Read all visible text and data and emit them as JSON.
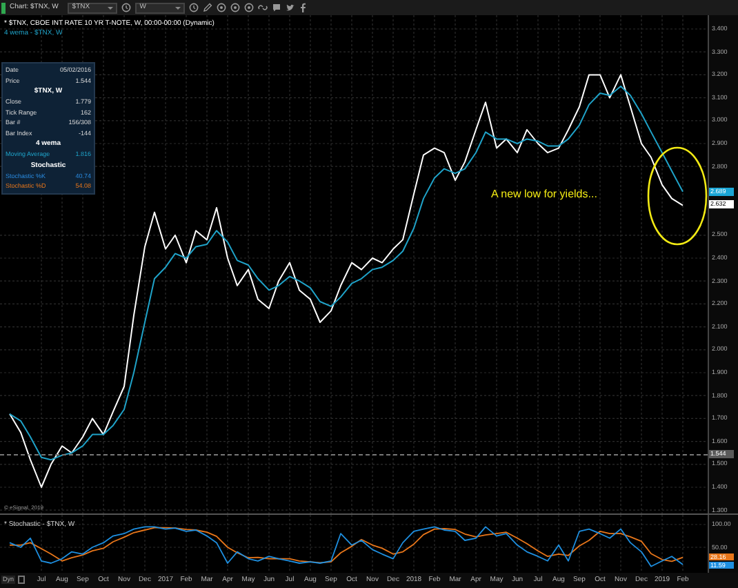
{
  "toolbar": {
    "title": "Chart: $TNX, W",
    "symbol_field": {
      "value": "$TNX"
    },
    "interval_field": {
      "value": "W"
    }
  },
  "chart": {
    "data_window": [
      {
        "kind": "pair",
        "label": "Date",
        "value": "05/02/2016"
      },
      {
        "kind": "pair",
        "label": "Price",
        "value": "1.544"
      },
      {
        "kind": "header",
        "label": "$TNX, W"
      },
      {
        "kind": "pair",
        "label": "Close",
        "value": "1.779"
      },
      {
        "kind": "pair",
        "label": "Tick Range",
        "value": "162"
      },
      {
        "kind": "pair",
        "label": "Bar #",
        "value": "156/308"
      },
      {
        "kind": "pair",
        "label": "Bar Index",
        "value": "-144"
      },
      {
        "kind": "header",
        "label": "4 wema"
      },
      {
        "kind": "moving_average",
        "label": "Moving Average",
        "value": "1.816"
      },
      {
        "kind": "header",
        "label": "Stochastic"
      },
      {
        "kind": "stochastic_k",
        "label": "Stochastic %K",
        "value": "40.74"
      },
      {
        "kind": "stochastic_d",
        "label": "Stochastic %D",
        "value": "54.08"
      }
    ],
    "annotation": "A new low for yields...",
    "axis_labels": [
      {
        "kind": "series_last",
        "text": "2.689",
        "color": "#1aa6d6"
      },
      {
        "kind": "series_last",
        "text": "2.632",
        "color": "#ffffff"
      }
    ],
    "copyright": "© eSignal, 2019",
    "chart_data": {
      "type": "line",
      "x": [
        "2016-05-15",
        "2016-06-01",
        "2016-06-15",
        "2016-07-01",
        "2016-07-15",
        "2016-08-01",
        "2016-08-15",
        "2016-09-01",
        "2016-09-15",
        "2016-10-01",
        "2016-10-15",
        "2016-11-01",
        "2016-11-15",
        "2016-12-01",
        "2016-12-15",
        "2017-01-01",
        "2017-01-15",
        "2017-02-01",
        "2017-02-15",
        "2017-03-01",
        "2017-03-15",
        "2017-04-01",
        "2017-04-15",
        "2017-05-01",
        "2017-05-15",
        "2017-06-01",
        "2017-06-15",
        "2017-07-01",
        "2017-07-15",
        "2017-08-01",
        "2017-08-15",
        "2017-09-01",
        "2017-09-15",
        "2017-10-01",
        "2017-10-15",
        "2017-11-01",
        "2017-11-15",
        "2017-12-01",
        "2017-12-15",
        "2018-01-01",
        "2018-01-15",
        "2018-02-01",
        "2018-02-15",
        "2018-03-01",
        "2018-03-15",
        "2018-04-01",
        "2018-04-15",
        "2018-05-01",
        "2018-05-15",
        "2018-06-01",
        "2018-06-15",
        "2018-07-01",
        "2018-07-15",
        "2018-08-01",
        "2018-08-15",
        "2018-09-01",
        "2018-09-15",
        "2018-10-01",
        "2018-10-15",
        "2018-11-01",
        "2018-11-15",
        "2018-12-01",
        "2018-12-15",
        "2019-01-01",
        "2019-01-15",
        "2019-02-01"
      ],
      "series": [
        {
          "name": "* $TNX, CBOE INT RATE 10 YR T-NOTE, W, 00:00-00:00 (Dynamic)",
          "color": "#ffffff",
          "values": [
            1.72,
            1.64,
            1.52,
            1.4,
            1.5,
            1.58,
            1.55,
            1.62,
            1.7,
            1.63,
            1.73,
            1.84,
            2.15,
            2.45,
            2.6,
            2.44,
            2.5,
            2.38,
            2.52,
            2.48,
            2.62,
            2.4,
            2.28,
            2.35,
            2.22,
            2.18,
            2.3,
            2.38,
            2.26,
            2.22,
            2.12,
            2.17,
            2.28,
            2.38,
            2.35,
            2.4,
            2.38,
            2.44,
            2.48,
            2.68,
            2.85,
            2.88,
            2.86,
            2.74,
            2.82,
            2.96,
            3.08,
            2.88,
            2.92,
            2.86,
            2.96,
            2.9,
            2.86,
            2.88,
            2.96,
            3.06,
            3.2,
            3.2,
            3.1,
            3.2,
            3.06,
            2.9,
            2.84,
            2.72,
            2.66,
            2.63
          ]
        },
        {
          "name": "4 wema - $TNX, W",
          "color": "#1fa3c9",
          "values": [
            1.72,
            1.69,
            1.62,
            1.53,
            1.52,
            1.54,
            1.55,
            1.58,
            1.63,
            1.63,
            1.67,
            1.74,
            1.9,
            2.12,
            2.31,
            2.36,
            2.42,
            2.4,
            2.45,
            2.46,
            2.52,
            2.47,
            2.39,
            2.37,
            2.31,
            2.26,
            2.28,
            2.32,
            2.3,
            2.27,
            2.21,
            2.19,
            2.23,
            2.29,
            2.31,
            2.35,
            2.36,
            2.39,
            2.43,
            2.53,
            2.66,
            2.75,
            2.79,
            2.77,
            2.79,
            2.86,
            2.95,
            2.92,
            2.92,
            2.9,
            2.92,
            2.91,
            2.89,
            2.89,
            2.92,
            2.98,
            3.07,
            3.12,
            3.11,
            3.15,
            3.11,
            3.03,
            2.95,
            2.86,
            2.78,
            2.69
          ]
        }
      ],
      "xlim": [
        "2016-05-01",
        "2019-03-07"
      ],
      "ylim": [
        1.3,
        3.4
      ],
      "grid": true,
      "ref_lines": [
        {
          "axis": "y",
          "value": 1.544,
          "label": "1.544"
        }
      ],
      "yticks": [
        {
          "value": 1.3,
          "label": "1.300"
        },
        {
          "value": 1.4,
          "label": "1.400"
        },
        {
          "value": 1.5,
          "label": "1.500"
        },
        {
          "value": 1.6,
          "label": "1.600"
        },
        {
          "value": 1.7,
          "label": "1.700"
        },
        {
          "value": 1.8,
          "label": "1.800"
        },
        {
          "value": 1.9,
          "label": "1.900"
        },
        {
          "value": 2.0,
          "label": "2.000"
        },
        {
          "value": 2.1,
          "label": "2.100"
        },
        {
          "value": 2.2,
          "label": "2.200"
        },
        {
          "value": 2.3,
          "label": "2.300"
        },
        {
          "value": 2.4,
          "label": "2.400"
        },
        {
          "value": 2.5,
          "label": "2.500"
        },
        {
          "value": 2.8,
          "label": "2.800"
        },
        {
          "value": 2.9,
          "label": "2.900"
        },
        {
          "value": 3.0,
          "label": "3.000"
        },
        {
          "value": 3.1,
          "label": "3.100"
        },
        {
          "value": 3.2,
          "label": "3.200"
        },
        {
          "value": 3.3,
          "label": "3.300"
        },
        {
          "value": 3.4,
          "label": "3.400"
        }
      ]
    }
  },
  "stochastic": {
    "legend": "* Stochastic - $TNX, W",
    "axis_labels": [
      {
        "kind": "series_last",
        "text": "28.16",
        "color": "#e8761a"
      },
      {
        "kind": "series_last",
        "text": "11.59",
        "color": "#1e8fe0"
      }
    ],
    "chart_data": {
      "type": "line",
      "x": [
        "2016-05-15",
        "2016-06-01",
        "2016-06-15",
        "2016-07-01",
        "2016-07-15",
        "2016-08-01",
        "2016-08-15",
        "2016-09-01",
        "2016-09-15",
        "2016-10-01",
        "2016-10-15",
        "2016-11-01",
        "2016-11-15",
        "2016-12-01",
        "2016-12-15",
        "2017-01-01",
        "2017-01-15",
        "2017-02-01",
        "2017-02-15",
        "2017-03-01",
        "2017-03-15",
        "2017-04-01",
        "2017-04-15",
        "2017-05-01",
        "2017-05-15",
        "2017-06-01",
        "2017-06-15",
        "2017-07-01",
        "2017-07-15",
        "2017-08-01",
        "2017-08-15",
        "2017-09-01",
        "2017-09-15",
        "2017-10-01",
        "2017-10-15",
        "2017-11-01",
        "2017-11-15",
        "2017-12-01",
        "2017-12-15",
        "2018-01-01",
        "2018-01-15",
        "2018-02-01",
        "2018-02-15",
        "2018-03-01",
        "2018-03-15",
        "2018-04-01",
        "2018-04-15",
        "2018-05-01",
        "2018-05-15",
        "2018-06-01",
        "2018-06-15",
        "2018-07-01",
        "2018-07-15",
        "2018-08-01",
        "2018-08-15",
        "2018-09-01",
        "2018-09-15",
        "2018-10-01",
        "2018-10-15",
        "2018-11-01",
        "2018-11-15",
        "2018-12-01",
        "2018-12-15",
        "2019-01-01",
        "2019-01-15",
        "2019-02-01"
      ],
      "series": [
        {
          "color": "#e8761a",
          "values": [
            55,
            55,
            60,
            47,
            35,
            20,
            27,
            33,
            42,
            48,
            62,
            72,
            82,
            88,
            93,
            93,
            92,
            89,
            88,
            83,
            74,
            50,
            38,
            27,
            28,
            25,
            25,
            25,
            20,
            18,
            16,
            18,
            38,
            52,
            67,
            55,
            48,
            35,
            40,
            57,
            78,
            90,
            91,
            89,
            79,
            73,
            77,
            80,
            83,
            70,
            58,
            42,
            30,
            35,
            32,
            53,
            65,
            85,
            80,
            80,
            73,
            63,
            36,
            23,
            19,
            28
          ]
        },
        {
          "color": "#1e8fe0",
          "values": [
            60,
            50,
            70,
            20,
            15,
            25,
            40,
            35,
            50,
            60,
            75,
            80,
            90,
            95,
            95,
            90,
            92,
            85,
            88,
            75,
            60,
            15,
            40,
            25,
            20,
            30,
            25,
            20,
            15,
            18,
            15,
            20,
            80,
            55,
            65,
            45,
            35,
            25,
            60,
            85,
            90,
            95,
            88,
            85,
            65,
            70,
            95,
            75,
            80,
            55,
            40,
            30,
            20,
            55,
            20,
            85,
            90,
            80,
            70,
            90,
            60,
            40,
            8,
            20,
            30,
            12
          ]
        }
      ],
      "xlim": [
        "2016-05-01",
        "2019-03-07"
      ],
      "ylim": [
        0,
        100
      ],
      "grid": true,
      "xticks": [
        {
          "value": "2016-07-01",
          "label": "Jul"
        },
        {
          "value": "2016-08-01",
          "label": "Aug"
        },
        {
          "value": "2016-09-01",
          "label": "Sep"
        },
        {
          "value": "2016-10-01",
          "label": "Oct"
        },
        {
          "value": "2016-11-01",
          "label": "Nov"
        },
        {
          "value": "2016-12-01",
          "label": "Dec"
        },
        {
          "value": "2017-01-01",
          "label": "2017"
        },
        {
          "value": "2017-02-01",
          "label": "Feb"
        },
        {
          "value": "2017-03-01",
          "label": "Mar"
        },
        {
          "value": "2017-04-01",
          "label": "Apr"
        },
        {
          "value": "2017-05-01",
          "label": "May"
        },
        {
          "value": "2017-06-01",
          "label": "Jun"
        },
        {
          "value": "2017-07-01",
          "label": "Jul"
        },
        {
          "value": "2017-08-01",
          "label": "Aug"
        },
        {
          "value": "2017-09-01",
          "label": "Sep"
        },
        {
          "value": "2017-10-01",
          "label": "Oct"
        },
        {
          "value": "2017-11-01",
          "label": "Nov"
        },
        {
          "value": "2017-12-01",
          "label": "Dec"
        },
        {
          "value": "2018-01-01",
          "label": "2018"
        },
        {
          "value": "2018-02-01",
          "label": "Feb"
        },
        {
          "value": "2018-03-01",
          "label": "Mar"
        },
        {
          "value": "2018-04-01",
          "label": "Apr"
        },
        {
          "value": "2018-05-01",
          "label": "May"
        },
        {
          "value": "2018-06-01",
          "label": "Jun"
        },
        {
          "value": "2018-07-01",
          "label": "Jul"
        },
        {
          "value": "2018-08-01",
          "label": "Aug"
        },
        {
          "value": "2018-09-01",
          "label": "Sep"
        },
        {
          "value": "2018-10-01",
          "label": "Oct"
        },
        {
          "value": "2018-11-01",
          "label": "Nov"
        },
        {
          "value": "2018-12-01",
          "label": "Dec"
        },
        {
          "value": "2019-01-01",
          "label": "2019"
        },
        {
          "value": "2019-02-01",
          "label": "Feb"
        }
      ],
      "yticks": [
        {
          "value": 50,
          "label": "50.00"
        },
        {
          "value": 100,
          "label": "100.00"
        }
      ]
    }
  },
  "bottom_bar": {
    "button": "Dyn"
  }
}
